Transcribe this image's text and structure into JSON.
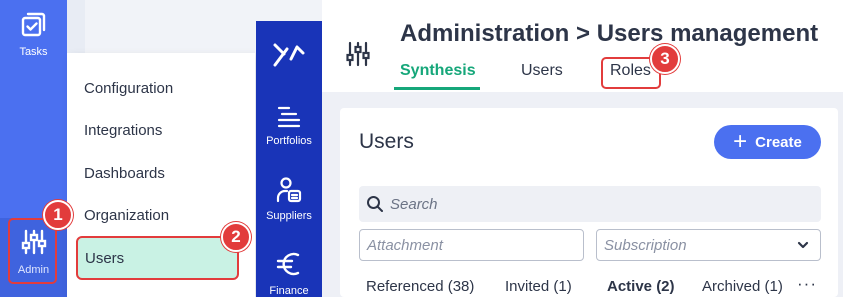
{
  "rail": {
    "tasks_label": "Tasks",
    "admin_label": "Admin"
  },
  "submenu": {
    "items": [
      "Configuration",
      "Integrations",
      "Dashboards",
      "Organization",
      "Users"
    ]
  },
  "product_nav": {
    "items": [
      {
        "label": "Portfolios",
        "icon": "portfolios-icon"
      },
      {
        "label": "Suppliers",
        "icon": "suppliers-icon"
      },
      {
        "label": "Finance",
        "icon": "euro-icon"
      }
    ]
  },
  "header": {
    "title": "Administration > Users management",
    "tabs": [
      "Synthesis",
      "Users",
      "Roles"
    ]
  },
  "card": {
    "title": "Users",
    "create_label": "Create",
    "search_placeholder": "Search",
    "attachment_placeholder": "Attachment",
    "subscription_placeholder": "Subscription",
    "filters": [
      "Referenced (38)",
      "Invited (1)",
      "Active (2)",
      "Archived (1)"
    ],
    "more_label": "···"
  },
  "badges": [
    "1",
    "2",
    "3"
  ],
  "colors": {
    "rail_blue": "#4b70f0",
    "nav_dark_blue": "#1934b8",
    "accent_green": "#16a77a",
    "highlight_red": "#e23c3c",
    "active_bg": "#c9f2e4"
  }
}
